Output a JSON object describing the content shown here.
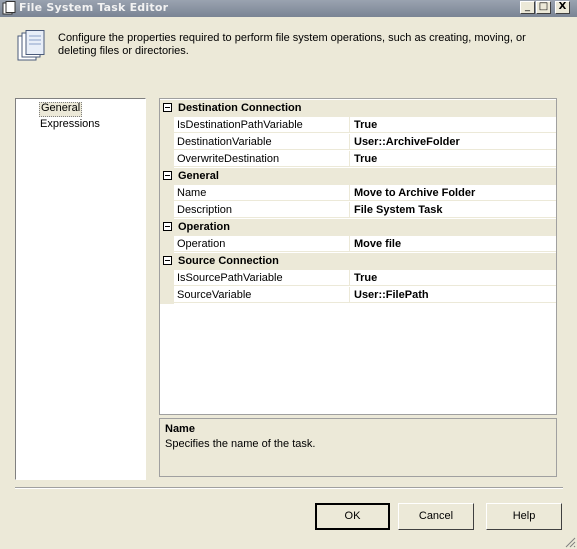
{
  "window": {
    "title": "File System Task Editor"
  },
  "header": {
    "description": "Configure the properties required to perform file system operations, such as creating, moving, or deleting files or directories."
  },
  "pages": [
    {
      "label": "General",
      "selected": true
    },
    {
      "label": "Expressions",
      "selected": false
    }
  ],
  "property_grid": {
    "categories": [
      {
        "label": "Destination Connection",
        "properties": [
          {
            "name": "IsDestinationPathVariable",
            "value": "True"
          },
          {
            "name": "DestinationVariable",
            "value": "User::ArchiveFolder"
          },
          {
            "name": "OverwriteDestination",
            "value": "True"
          }
        ]
      },
      {
        "label": "General",
        "properties": [
          {
            "name": "Name",
            "value": "Move to Archive Folder"
          },
          {
            "name": "Description",
            "value": "File System Task"
          }
        ]
      },
      {
        "label": "Operation",
        "properties": [
          {
            "name": "Operation",
            "value": "Move file"
          }
        ]
      },
      {
        "label": "Source Connection",
        "properties": [
          {
            "name": "IsSourcePathVariable",
            "value": "True"
          },
          {
            "name": "SourceVariable",
            "value": "User::FilePath"
          }
        ]
      }
    ]
  },
  "description_panel": {
    "title": "Name",
    "text": "Specifies the name of the task."
  },
  "buttons": {
    "ok": "OK",
    "cancel": "Cancel",
    "help": "Help"
  },
  "title_buttons": {
    "minimize": "_",
    "maximize": "□",
    "close": "X"
  },
  "colors": {
    "dialog_bg": "#ece9d8",
    "titlebar": "#8a93a2",
    "grid_bg": "#ffffff"
  }
}
